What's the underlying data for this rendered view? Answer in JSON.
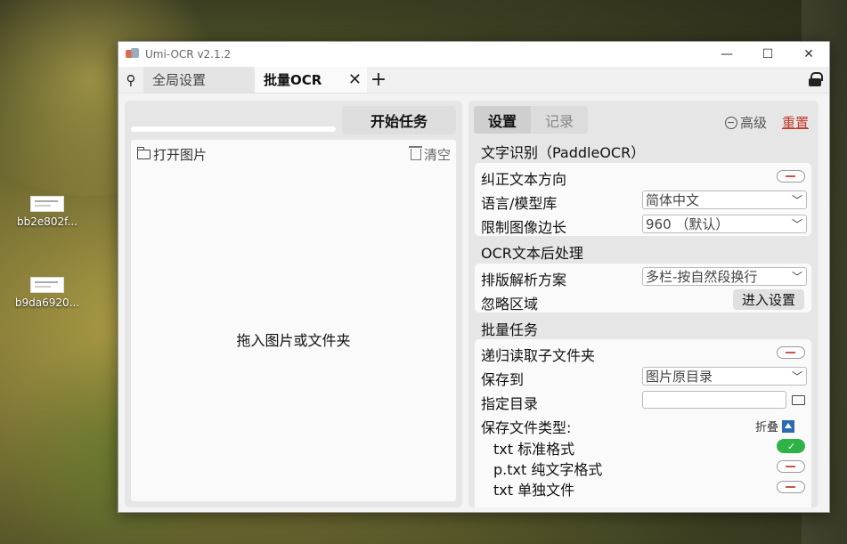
{
  "desktop": {
    "icons": [
      {
        "label": "bb2e802f..."
      },
      {
        "label": "b9da6920..."
      }
    ]
  },
  "window": {
    "title": "Umi-OCR v2.1.2",
    "controls": {
      "minimize": "—",
      "maximize": "☐",
      "close": "✕"
    }
  },
  "tabs": {
    "pin": "📌",
    "global_settings": "全局设置",
    "batch_ocr": "批量OCR",
    "close": "✕",
    "add": "+"
  },
  "left": {
    "start_button": "开始任务",
    "open_images": "打开图片",
    "clear": "清空",
    "drop_hint": "拖入图片或文件夹"
  },
  "right": {
    "tab_settings": "设置",
    "tab_records": "记录",
    "advanced": "高级",
    "reset": "重置",
    "sections": {
      "ocr": "文字识别（PaddleOCR）",
      "post": "OCR文本后处理",
      "batch": "批量任务"
    },
    "ocr": {
      "correct_direction": "纠正文本方向",
      "language": "语言/模型库",
      "language_value": "简体中文",
      "limit_side": "限制图像边长",
      "limit_side_value": "960 （默认）"
    },
    "post": {
      "layout": "排版解析方案",
      "layout_value": "多栏-按自然段换行",
      "ignore_area": "忽略区域",
      "enter_settings": "进入设置"
    },
    "batch": {
      "recursive": "递归读取子文件夹",
      "save_to": "保存到",
      "save_to_value": "图片原目录",
      "target_dir": "指定目录",
      "target_dir_value": "",
      "file_types": "保存文件类型:",
      "fold": "折叠",
      "txt_standard": "txt 标准格式",
      "ptxt": "p.txt 纯文字格式",
      "txt_single": "txt 单独文件"
    },
    "status_colors": {
      "on": "#2fb347",
      "off_mark": "#d2524a",
      "reset": "#c0392b"
    }
  }
}
